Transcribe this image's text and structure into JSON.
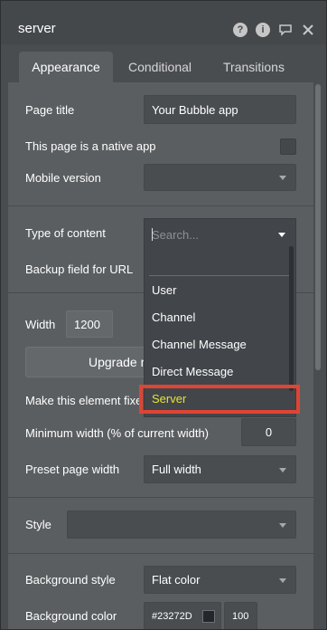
{
  "header": {
    "title": "server",
    "icons": [
      "question-icon",
      "info-icon",
      "comment-icon",
      "close-icon"
    ]
  },
  "tabs": [
    {
      "label": "Appearance",
      "active": true
    },
    {
      "label": "Conditional",
      "active": false
    },
    {
      "label": "Transitions",
      "active": false
    }
  ],
  "page_title": {
    "label": "Page title",
    "value": "Your Bubble app"
  },
  "native_app": {
    "label": "This page is a native app",
    "checked": false
  },
  "mobile_version": {
    "label": "Mobile version",
    "value": ""
  },
  "type_of_content": {
    "label": "Type of content",
    "search_placeholder": "Search...",
    "options": [
      "User",
      "Channel",
      "Channel Message",
      "Direct Message",
      "Server"
    ],
    "highlighted": "Server"
  },
  "backup_field": {
    "label": "Backup field for URL"
  },
  "width": {
    "label": "Width",
    "value": "1200"
  },
  "upgrade_button": {
    "label": "Upgrade re"
  },
  "fixed_width": {
    "label": "Make this element fixe"
  },
  "min_width": {
    "label": "Minimum width (% of current width)",
    "value": "0"
  },
  "preset_width": {
    "label": "Preset page width",
    "value": "Full width"
  },
  "style": {
    "label": "Style",
    "value": ""
  },
  "background_style": {
    "label": "Background style",
    "value": "Flat color"
  },
  "background_color": {
    "label": "Background color",
    "value": "#23272D",
    "opacity": "100"
  },
  "colors": {
    "accent_highlight": "#E3E33A",
    "annotation_box": "#E04433"
  }
}
